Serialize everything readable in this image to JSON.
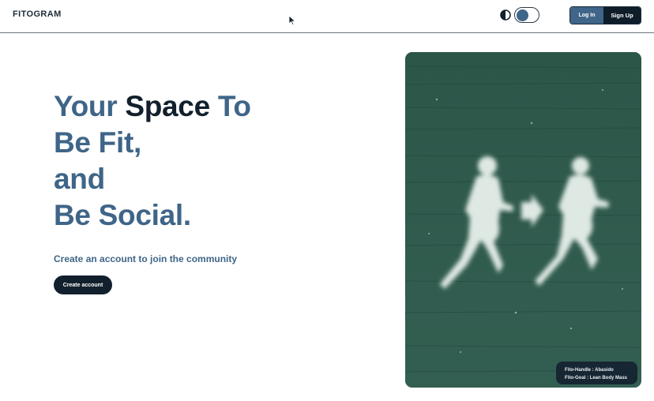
{
  "header": {
    "brand": "FITOGRAM",
    "login_label": "Log In",
    "signup_label": "Sign Up",
    "theme_icon": "contrast-icon"
  },
  "hero": {
    "title_word_1": "Your",
    "title_word_2": "Space",
    "title_word_3": "To",
    "title_line_2": "Be Fit,",
    "title_line_3": "and",
    "title_line_4": "Be Social.",
    "subtitle": "Create an account to join the community",
    "cta_label": "Create account"
  },
  "photo_card": {
    "handle_line": "Fito-Handle : Abasido",
    "goal_line": "Fito-Goal : Lean Body Mass"
  },
  "colors": {
    "accent": "#3f6588",
    "dark": "#12202d",
    "photo_bg": "#2f5a4e"
  }
}
